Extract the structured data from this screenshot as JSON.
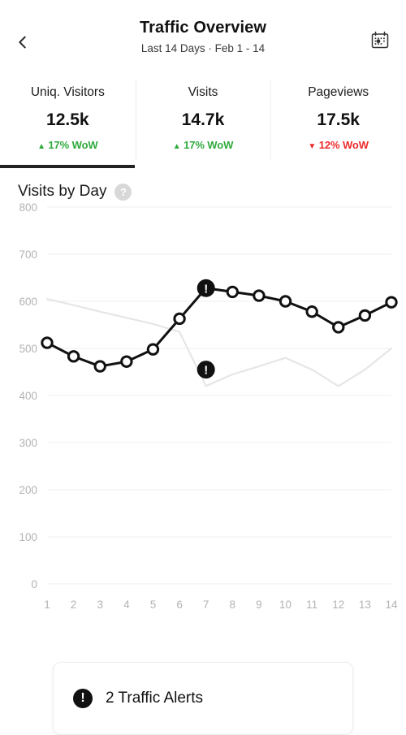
{
  "header": {
    "title": "Traffic Overview",
    "subtitle": "Last 14 Days · Feb 1 - 14",
    "back_icon": "chevron-left-icon",
    "calendar_icon": "calendar-icon"
  },
  "stats": [
    {
      "label": "Uniq. Visitors",
      "value": "12.5k",
      "delta": "17% WoW",
      "arrow": "▲",
      "color": "#2eaa3c",
      "active": true
    },
    {
      "label": "Visits",
      "value": "14.7k",
      "delta": "17% WoW",
      "arrow": "▲",
      "color": "#2eaa3c",
      "active": false
    },
    {
      "label": "Pageviews",
      "value": "17.5k",
      "delta": "12% WoW",
      "arrow": "▼",
      "color": "#ee2a2a",
      "active": false
    }
  ],
  "chart_section": {
    "title": "Visits by Day",
    "help_icon": "help-circle-icon",
    "help_glyph": "?"
  },
  "alerts": {
    "icon": "alert-exclamation-icon",
    "glyph": "!",
    "text": "2 Traffic Alerts"
  },
  "chart_data": {
    "type": "line",
    "title": "Visits by Day",
    "xlabel": "",
    "ylabel": "",
    "ylim": [
      0,
      800
    ],
    "yticks": [
      0,
      100,
      200,
      300,
      400,
      500,
      600,
      700,
      800
    ],
    "ytick_labels": [
      "0",
      "100",
      "200",
      "300",
      "400",
      "500",
      "600",
      "700",
      "800"
    ],
    "x": [
      1,
      2,
      3,
      4,
      5,
      6,
      7,
      8,
      9,
      10,
      11,
      12,
      13,
      14
    ],
    "xtick_labels": [
      "1",
      "2",
      "3",
      "4",
      "5",
      "6",
      "7",
      "8",
      "9",
      "10",
      "11",
      "12",
      "13",
      "14"
    ],
    "grid": true,
    "legend": "none",
    "series": [
      {
        "name": "Visits",
        "color": "#111111",
        "style": "solid-markers",
        "values": [
          512,
          483,
          462,
          472,
          498,
          563,
          628,
          620,
          612,
          600,
          578,
          545,
          570,
          598
        ]
      },
      {
        "name": "Previous Period",
        "color": "#e6e6e6",
        "style": "solid-thin",
        "values": [
          605,
          592,
          578,
          565,
          552,
          535,
          420,
          445,
          462,
          480,
          455,
          420,
          455,
          500
        ]
      }
    ],
    "annotations": [
      {
        "name": "alert-marker-peak",
        "x": 7,
        "y": 628,
        "series": "Visits",
        "glyph": "!"
      },
      {
        "name": "alert-marker-drop",
        "x": 7,
        "y": 455,
        "series": "Previous Period",
        "glyph": "!"
      }
    ]
  }
}
